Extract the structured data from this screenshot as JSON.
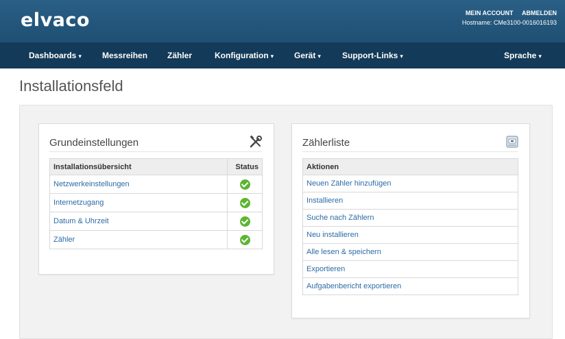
{
  "brand": {
    "logo": "elvaco"
  },
  "account": {
    "my_account": "MEIN ACCOUNT",
    "logout": "ABMELDEN",
    "hostname": "Hostname: CMe3100-0016016193"
  },
  "nav": [
    {
      "label": "Dashboards",
      "dropdown": true
    },
    {
      "label": "Messreihen",
      "dropdown": false
    },
    {
      "label": "Zähler",
      "dropdown": false
    },
    {
      "label": "Konfiguration",
      "dropdown": true
    },
    {
      "label": "Gerät",
      "dropdown": true
    },
    {
      "label": "Support-Links",
      "dropdown": true
    },
    {
      "label": "Sprache",
      "dropdown": true
    }
  ],
  "page": {
    "title": "Installationsfeld"
  },
  "basic_settings": {
    "title": "Grundeinstellungen",
    "icon": "tools-icon",
    "col_overview": "Installationsübersicht",
    "col_status": "Status",
    "rows": [
      {
        "label": "Netzwerkeinstellungen",
        "status": "ok"
      },
      {
        "label": "Internetzugang",
        "status": "ok"
      },
      {
        "label": "Datum & Uhrzeit",
        "status": "ok"
      },
      {
        "label": "Zähler",
        "status": "ok"
      }
    ]
  },
  "meter_list": {
    "title": "Zählerliste",
    "icon": "meter-icon",
    "col_actions": "Aktionen",
    "actions": [
      "Neuen Zähler hinzufügen",
      "Installieren",
      "Suche nach Zählern",
      "Neu installieren",
      "Alle lesen & speichern",
      "Exportieren",
      "Aufgabenbericht exportieren"
    ]
  },
  "colors": {
    "header": "#1f4f73",
    "nav": "#133a58",
    "link": "#2c6ba5",
    "status_ok": "#5cb531"
  }
}
